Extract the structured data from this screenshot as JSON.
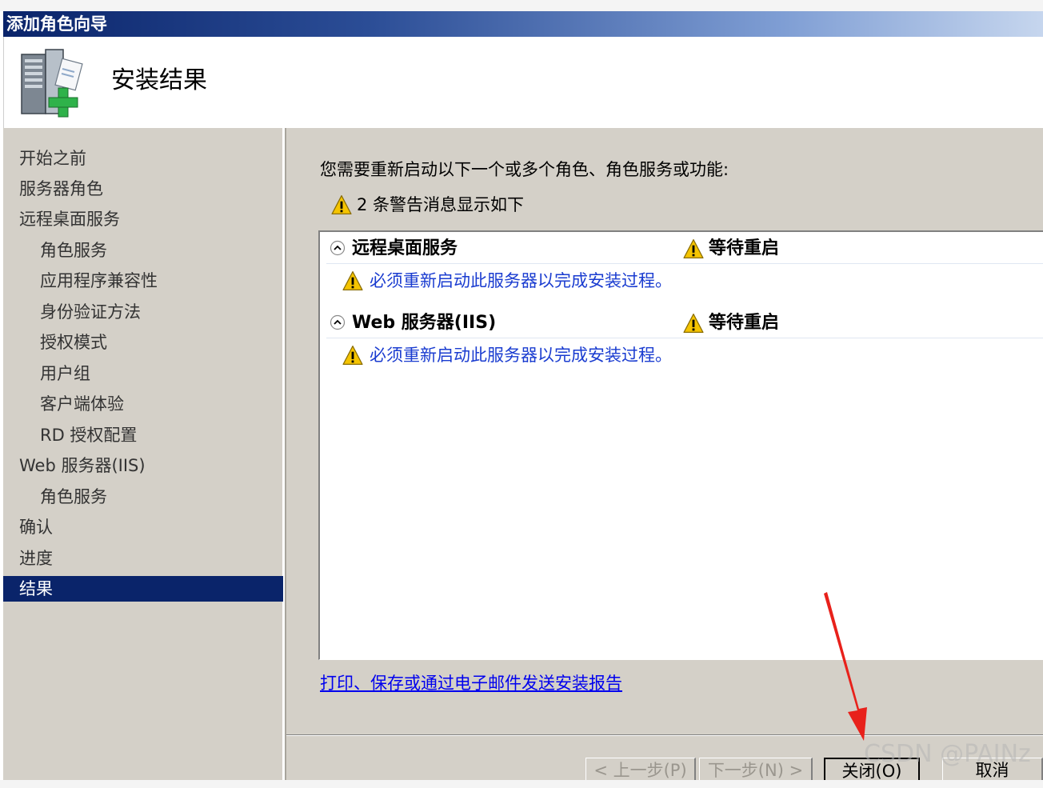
{
  "window": {
    "title": "添加角色向导"
  },
  "header": {
    "title": "安装结果",
    "icon": "server-add-icon"
  },
  "nav": {
    "items": [
      {
        "label": "开始之前",
        "level": 0,
        "selected": false
      },
      {
        "label": "服务器角色",
        "level": 0,
        "selected": false
      },
      {
        "label": "远程桌面服务",
        "level": 0,
        "selected": false
      },
      {
        "label": "角色服务",
        "level": 1,
        "selected": false
      },
      {
        "label": "应用程序兼容性",
        "level": 1,
        "selected": false
      },
      {
        "label": "身份验证方法",
        "level": 1,
        "selected": false
      },
      {
        "label": "授权模式",
        "level": 1,
        "selected": false
      },
      {
        "label": "用户组",
        "level": 1,
        "selected": false
      },
      {
        "label": "客户端体验",
        "level": 1,
        "selected": false
      },
      {
        "label": "RD 授权配置",
        "level": 1,
        "selected": false
      },
      {
        "label": "Web 服务器(IIS)",
        "level": 0,
        "selected": false
      },
      {
        "label": "角色服务",
        "level": 1,
        "selected": false
      },
      {
        "label": "确认",
        "level": 0,
        "selected": false
      },
      {
        "label": "进度",
        "level": 0,
        "selected": false
      },
      {
        "label": "结果",
        "level": 0,
        "selected": true
      }
    ]
  },
  "content": {
    "message": "您需要重新启动以下一个或多个角色、角色服务或功能:",
    "warning_summary": "2 条警告消息显示如下",
    "groups": [
      {
        "name": "远程桌面服务",
        "status": "等待重启",
        "detail": "必须重新启动此服务器以完成安装过程。"
      },
      {
        "name": "Web 服务器(IIS)",
        "status": "等待重启",
        "detail": "必须重新启动此服务器以完成安装过程。"
      }
    ],
    "report_link": "打印、保存或通过电子邮件发送安装报告"
  },
  "buttons": {
    "prev": "< 上一步(P)",
    "next": "下一步(N) >",
    "close": "关闭(O)",
    "cancel": "取消"
  },
  "watermark": "CSDN @PAINz",
  "colors": {
    "selection": "#0a246a",
    "link": "#0000ee",
    "warning": "#f5c400"
  }
}
